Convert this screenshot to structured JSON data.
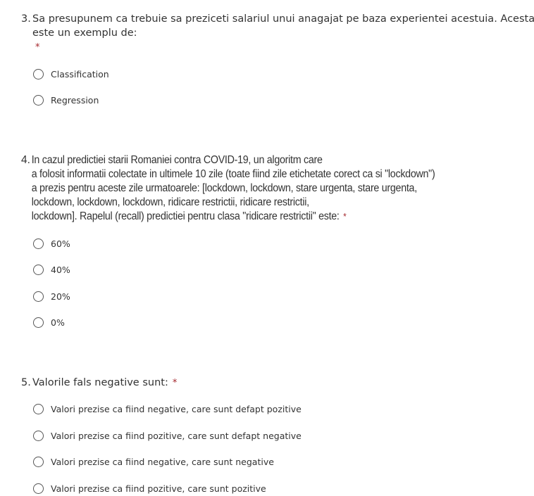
{
  "questions": [
    {
      "number": "3.",
      "lines": [
        "Sa presupunem ca trebuie sa preziceti salariul unui anagajat pe baza experientei acestuia. Acesta",
        "este un exemplu de:"
      ],
      "required": "*",
      "options": [
        "Classification",
        "Regression"
      ]
    },
    {
      "number": "4.",
      "lines": [
        "In cazul predictiei starii Romaniei contra COVID-19, un algoritm care",
        "a folosit informatii colectate in ultimele 10 zile (toate fiind zile etichetate corect ca si \"lockdown\")",
        "a prezis pentru aceste zile urmatoarele: [lockdown, lockdown, stare urgenta, stare urgenta,",
        "lockdown, lockdown, lockdown, ridicare restrictii, ridicare restrictii,",
        "lockdown]. Rapelul (recall) predictiei pentru clasa \"ridicare restrictii\" este:"
      ],
      "required": "*",
      "options": [
        "60%",
        "40%",
        "20%",
        "0%"
      ]
    },
    {
      "number": "5.",
      "lines": [
        "Valorile fals negative sunt:"
      ],
      "required": "*",
      "options": [
        "Valori prezise ca fiind negative, care sunt defapt pozitive",
        "Valori prezise ca fiind pozitive, care sunt defapt negative",
        "Valori prezise ca fiind negative, care sunt negative",
        "Valori prezise ca fiind pozitive, care sunt pozitive"
      ]
    }
  ]
}
